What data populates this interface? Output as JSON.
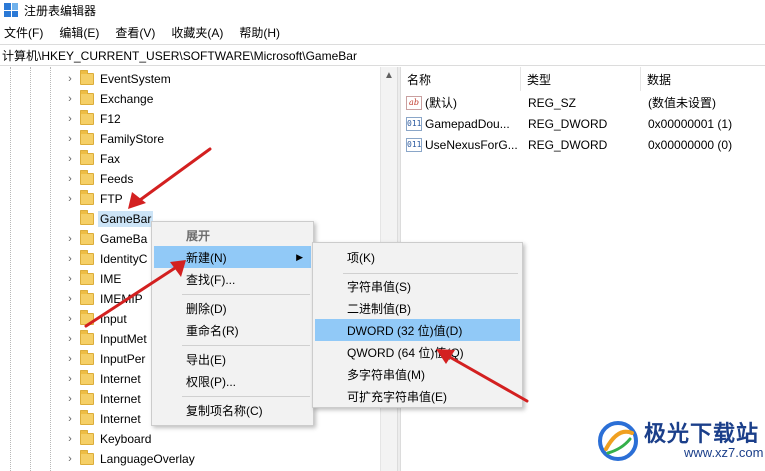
{
  "window": {
    "title": "注册表编辑器"
  },
  "menu": [
    "文件(F)",
    "编辑(E)",
    "查看(V)",
    "收藏夹(A)",
    "帮助(H)"
  ],
  "address": "计算机\\HKEY_CURRENT_USER\\SOFTWARE\\Microsoft\\GameBar",
  "tree": {
    "items": [
      {
        "label": "EventSystem",
        "expandable": true
      },
      {
        "label": "Exchange",
        "expandable": true
      },
      {
        "label": "F12",
        "expandable": true
      },
      {
        "label": "FamilyStore",
        "expandable": true
      },
      {
        "label": "Fax",
        "expandable": true
      },
      {
        "label": "Feeds",
        "expandable": true
      },
      {
        "label": "FTP",
        "expandable": true
      },
      {
        "label": "GameBar",
        "expandable": false,
        "selected": true
      },
      {
        "label": "GameBa",
        "expandable": true
      },
      {
        "label": "IdentityC",
        "expandable": true
      },
      {
        "label": "IME",
        "expandable": true
      },
      {
        "label": "IMEMIP",
        "expandable": true
      },
      {
        "label": "Input",
        "expandable": true
      },
      {
        "label": "InputMet",
        "expandable": true
      },
      {
        "label": "InputPer",
        "expandable": true
      },
      {
        "label": "Internet",
        "expandable": true
      },
      {
        "label": "Internet",
        "expandable": true
      },
      {
        "label": "Internet",
        "expandable": true
      },
      {
        "label": "Keyboard",
        "expandable": true
      },
      {
        "label": "LanguageOverlay",
        "expandable": true
      }
    ]
  },
  "values": {
    "headers": {
      "name": "名称",
      "type": "类型",
      "data": "数据"
    },
    "rows": [
      {
        "icon": "ab",
        "name": "(默认)",
        "type": "REG_SZ",
        "data": "(数值未设置)"
      },
      {
        "icon": "011",
        "name": "GamepadDou...",
        "type": "REG_DWORD",
        "data": "0x00000001 (1)"
      },
      {
        "icon": "011",
        "name": "UseNexusForG...",
        "type": "REG_DWORD",
        "data": "0x00000000 (0)"
      }
    ]
  },
  "context_menu": {
    "items": [
      {
        "label": "展开",
        "disabled": true
      },
      {
        "label": "新建(N)",
        "submenu": true,
        "highlighted": true
      },
      {
        "label": "查找(F)..."
      },
      {
        "label": "删除(D)"
      },
      {
        "label": "重命名(R)"
      },
      {
        "label": "导出(E)"
      },
      {
        "label": "权限(P)..."
      },
      {
        "label": "复制项名称(C)"
      }
    ]
  },
  "submenu": {
    "items": [
      {
        "label": "项(K)"
      },
      {
        "label": "字符串值(S)"
      },
      {
        "label": "二进制值(B)"
      },
      {
        "label": "DWORD (32 位)值(D)",
        "highlighted": true
      },
      {
        "label": "QWORD (64 位)值(Q)"
      },
      {
        "label": "多字符串值(M)"
      },
      {
        "label": "可扩充字符串值(E)"
      }
    ]
  },
  "watermark": {
    "title": "极光下载站",
    "url": "www.xz7.com"
  },
  "colors": {
    "highlight": "#91c9f7",
    "selection": "#cce4f7",
    "annotation": "#d32020",
    "watermark": "#1b3f8a"
  }
}
